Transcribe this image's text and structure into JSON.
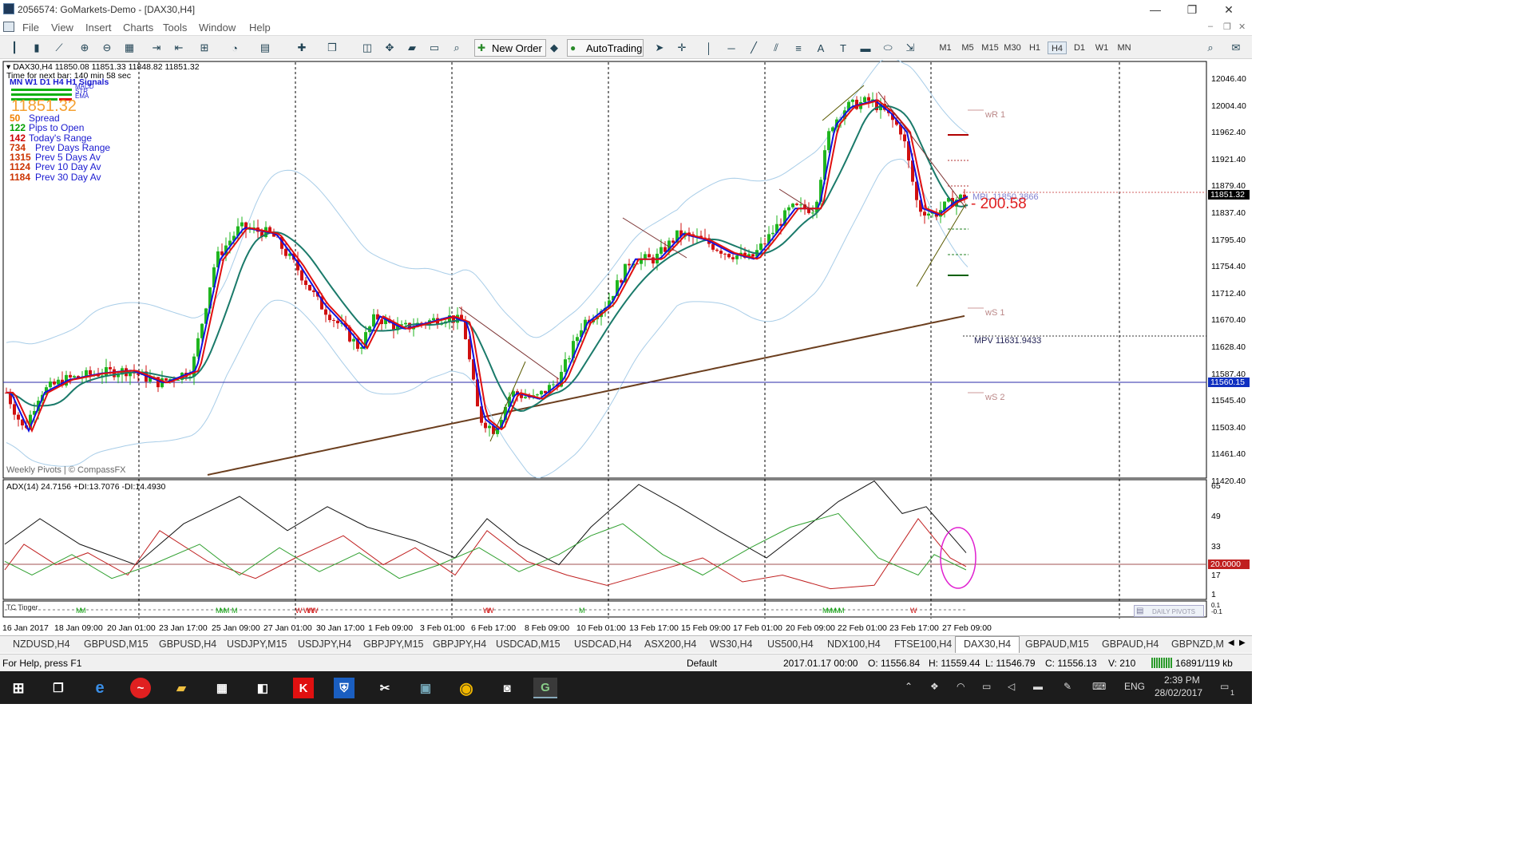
{
  "window": {
    "title": "2056574: GoMarkets-Demo - [DAX30,H4]",
    "min": "—",
    "restore": "❐",
    "close": "✕"
  },
  "menu": [
    "File",
    "View",
    "Insert",
    "Charts",
    "Tools",
    "Window",
    "Help"
  ],
  "toolbar": {
    "new_order": "New Order",
    "autotrading": "AutoTrading",
    "timeframes": [
      "M1",
      "M5",
      "M15",
      "M30",
      "H1",
      "H4",
      "D1",
      "W1",
      "MN"
    ],
    "active_tf": "H4"
  },
  "chart": {
    "header": "DAX30,H4  11850.08 11851.33 11848.82 11851.32",
    "next_bar": "Time for next bar: 140 min 58 sec",
    "signals_title": "MN W1 D1  H4  H1  Signals",
    "signal_rows": [
      "MACD",
      "STR",
      "EMA"
    ],
    "big_price": "11851.32",
    "stats": [
      {
        "value": "50",
        "label": "Spread",
        "color": "#f08000"
      },
      {
        "value": "122",
        "label": "Pips to Open",
        "color": "#00a000"
      },
      {
        "value": "142",
        "label": "Today's Range",
        "color": "#cc0000"
      },
      {
        "value": "734",
        "label": "Prev Days Range",
        "color": "#cc3300"
      },
      {
        "value": "1315",
        "label": "Prev 5 Days Av",
        "color": "#cc3300"
      },
      {
        "value": "1124",
        "label": "Prev 10 Day Av",
        "color": "#cc3300"
      },
      {
        "value": "1184",
        "label": "Prev 30 Day Av",
        "color": "#cc3300"
      }
    ],
    "pivot_labels": {
      "wr1": "wR 1",
      "ws1": "wS 1",
      "ws2": "wS 2",
      "mpv": "MPV   11631.9433",
      "mpl": "MPL   11850.3866",
      "dist": "- 200.58"
    },
    "footer": "Weekly Pivots | © CompassFX",
    "price_axis": [
      "12046.40",
      "12004.40",
      "11962.40",
      "11921.40",
      "11879.40",
      "11837.40",
      "11795.40",
      "11754.40",
      "11712.40",
      "11670.40",
      "11628.40",
      "11587.40",
      "11545.40",
      "11503.40",
      "11461.40",
      "11420.40"
    ],
    "current_price": "11851.32",
    "hline_price": "11560.15",
    "adx_header": "ADX(14) 24.7156 +DI:13.7076 -DI:14.4930",
    "adx_axis": [
      "65",
      "49",
      "33",
      "17",
      "1"
    ],
    "adx_level": "20.0000",
    "tc_label": "TC Tinger",
    "daily_pivots": "DAILY PIVOTS",
    "sub_axis": [
      "0.1",
      "-0.1"
    ],
    "time_axis": [
      "16 Jan 2017",
      "18 Jan 09:00",
      "20 Jan 01:00",
      "23 Jan 17:00",
      "25 Jan 09:00",
      "27 Jan 01:00",
      "30 Jan 17:00",
      "1 Feb 09:00",
      "3 Feb 01:00",
      "6 Feb 17:00",
      "8 Feb 09:00",
      "10 Feb 01:00",
      "13 Feb 17:00",
      "15 Feb 09:00",
      "17 Feb 01:00",
      "20 Feb 09:00",
      "22 Feb 01:00",
      "23 Feb 17:00",
      "27 Feb 09:00"
    ]
  },
  "tabs": [
    "NZDUSD,H4",
    "GBPUSD,M15",
    "GBPUSD,H4",
    "USDJPY,M15",
    "USDJPY,H4",
    "GBPJPY,M15",
    "GBPJPY,H4",
    "USDCAD,M15",
    "USDCAD,H4",
    "ASX200,H4",
    "WS30,H4",
    "US500,H4",
    "NDX100,H4",
    "FTSE100,H4",
    "DAX30,H4",
    "GBPAUD,M15",
    "GBPAUD,H4",
    "GBPNZD,M"
  ],
  "active_tab": "DAX30,H4",
  "status": {
    "help": "For Help, press F1",
    "profile": "Default",
    "time": "2017.01.17 00:00",
    "open": "O: 11556.84",
    "high": "H: 11559.44",
    "low": "L: 11546.79",
    "close": "C: 11556.13",
    "volume": "V: 210",
    "traffic": "16891/119 kb"
  },
  "taskbar": {
    "lang": "ENG",
    "time": "2:39 PM",
    "date": "28/02/2017",
    "notif": "1"
  }
}
